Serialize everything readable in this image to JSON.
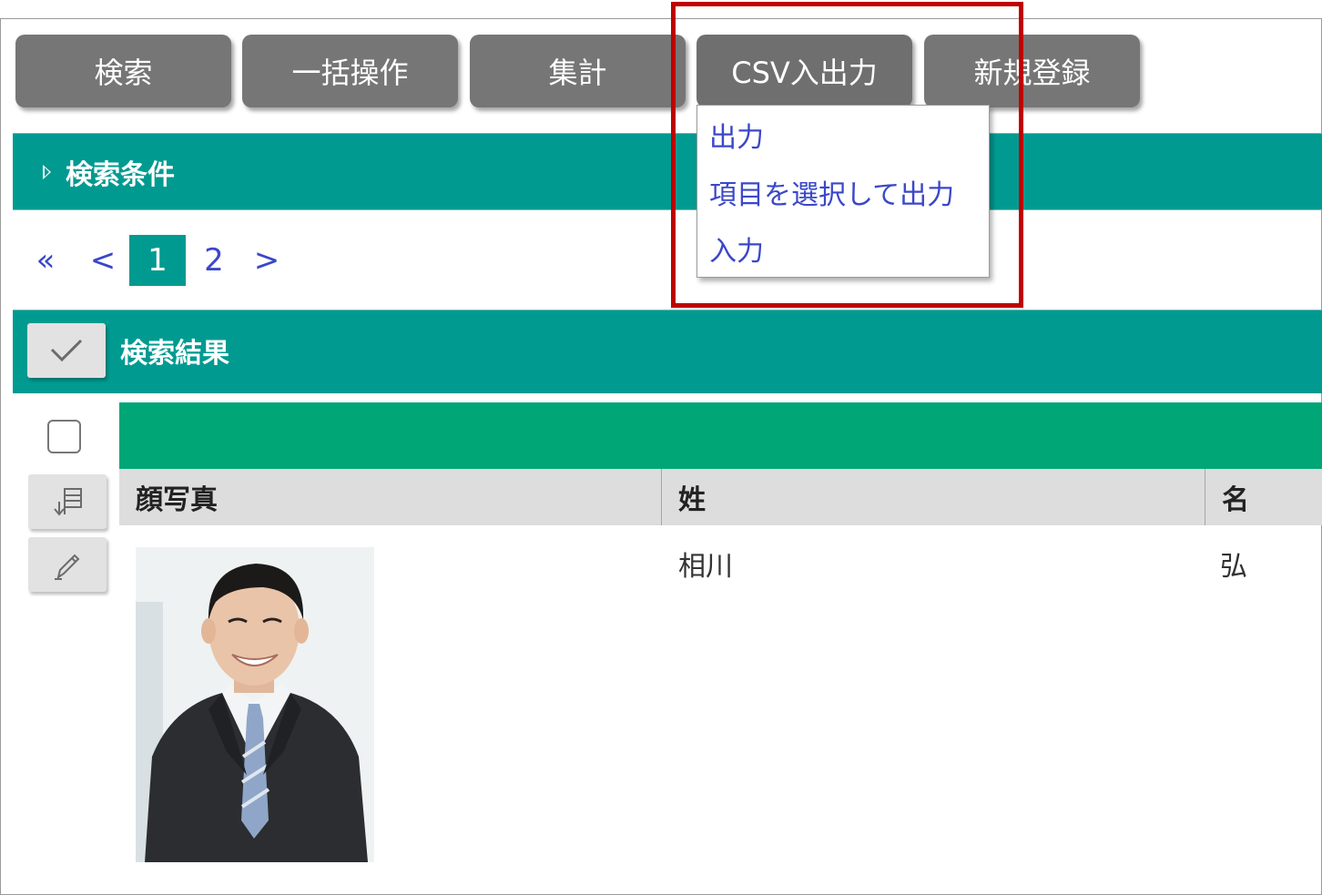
{
  "toolbar": {
    "buttons": [
      {
        "label": "検索"
      },
      {
        "label": "一括操作"
      },
      {
        "label": "集計"
      },
      {
        "label": "CSV入出力"
      },
      {
        "label": "新規登録"
      }
    ]
  },
  "csv_menu": {
    "items": [
      {
        "label": "出力"
      },
      {
        "label": "項目を選択して出力"
      },
      {
        "label": "入力"
      }
    ]
  },
  "search_conditions": {
    "title": "検索条件"
  },
  "pagination": {
    "first": "«",
    "prev": "<",
    "pages": [
      "1",
      "2"
    ],
    "current": "1",
    "next": ">"
  },
  "results": {
    "title": "検索結果",
    "columns": [
      "顔写真",
      "姓",
      "名"
    ],
    "rows": [
      {
        "last_name": "相川",
        "first_name": "弘"
      }
    ]
  },
  "icons": {
    "check_all": "checkmark-icon",
    "sort": "sort-icon",
    "edit": "pencil-icon"
  },
  "colors": {
    "toolbar_button": "#767676",
    "section_bar": "#009a91",
    "table_header_strip": "#00a676",
    "link": "#3b47c9",
    "highlight": "#c00000"
  }
}
